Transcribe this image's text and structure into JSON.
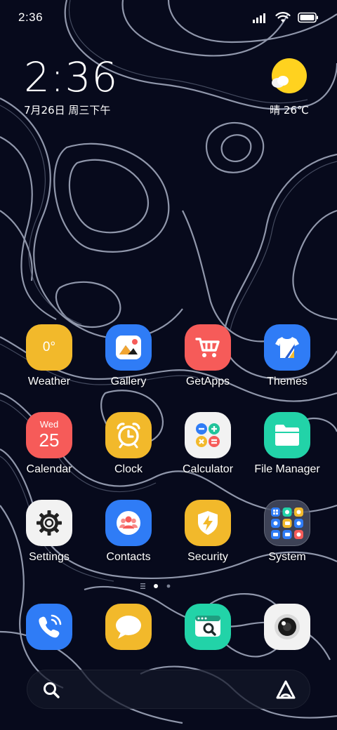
{
  "status_bar": {
    "time": "2:36"
  },
  "clock_widget": {
    "time": "2:36",
    "date": "7月26日 周三下午"
  },
  "weather_widget": {
    "text": "晴 26℃"
  },
  "apps": [
    {
      "label": "Weather",
      "icon": "weather-icon",
      "icon_text": "0°",
      "color": "#f2b92b"
    },
    {
      "label": "Gallery",
      "icon": "gallery-icon",
      "color": "#2f7cf6"
    },
    {
      "label": "GetApps",
      "icon": "cart-icon",
      "color": "#f65b59"
    },
    {
      "label": "Themes",
      "icon": "shirt-icon",
      "color": "#2f7cf6"
    },
    {
      "label": "Calendar",
      "icon": "calendar-icon",
      "icon_day": "Wed",
      "icon_date": "25",
      "color": "#f65b59"
    },
    {
      "label": "Clock",
      "icon": "alarm-clock-icon",
      "color": "#f2b92b"
    },
    {
      "label": "Calculator",
      "icon": "calculator-icon",
      "color": "#f2f2f2"
    },
    {
      "label": "File Manager",
      "icon": "folder-icon",
      "color": "#22d3a8"
    },
    {
      "label": "Settings",
      "icon": "gear-icon",
      "color": "#f2f2f2"
    },
    {
      "label": "Contacts",
      "icon": "contacts-icon",
      "color": "#2f7cf6"
    },
    {
      "label": "Security",
      "icon": "shield-icon",
      "color": "#f2b92b"
    },
    {
      "label": "System",
      "icon": "folder-grid-icon",
      "color": "#3a3f52"
    }
  ],
  "dock": [
    {
      "name": "Phone",
      "icon": "phone-icon",
      "color": "#2f7cf6"
    },
    {
      "name": "Messaging",
      "icon": "message-icon",
      "color": "#f2b92b"
    },
    {
      "name": "Browser",
      "icon": "browser-search-icon",
      "color": "#22d3a8"
    },
    {
      "name": "Camera",
      "icon": "camera-icon",
      "color": "#f2f2f2"
    }
  ],
  "page_indicator": {
    "pages": 2,
    "current": 1
  }
}
